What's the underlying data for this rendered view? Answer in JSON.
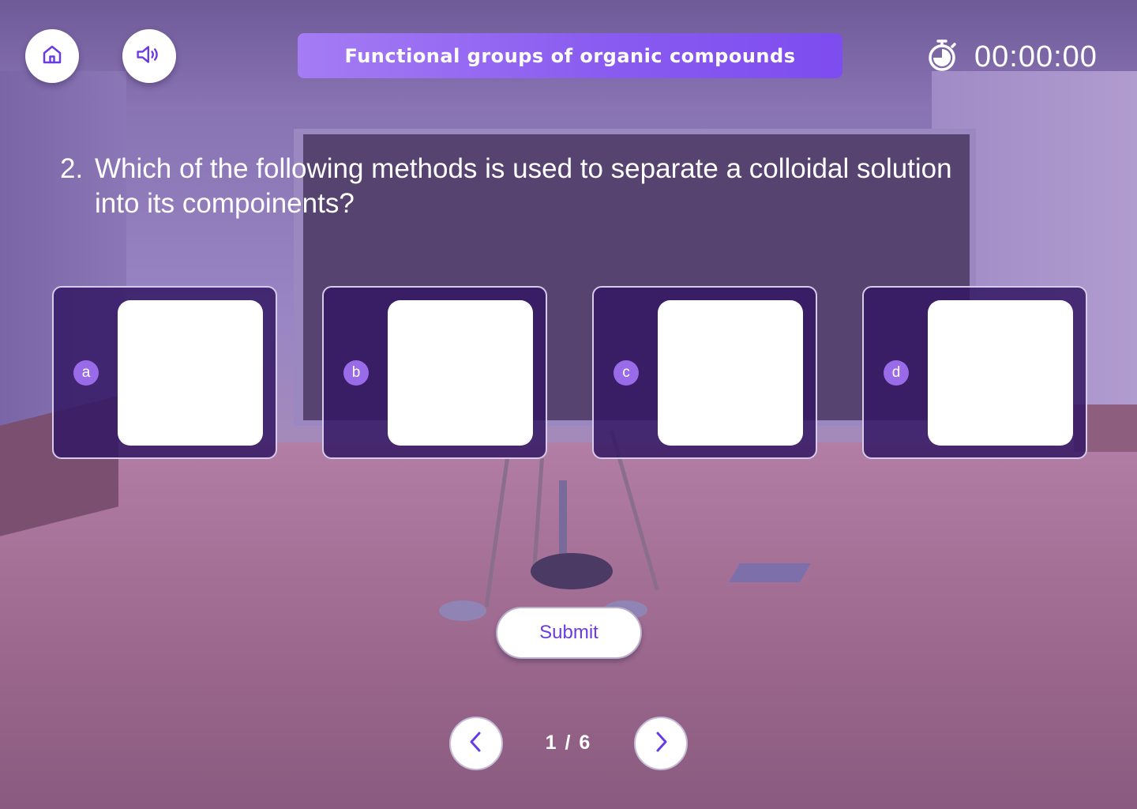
{
  "header": {
    "title": "Functional groups of organic compounds",
    "timer": "00:00:00",
    "home_icon": "home-icon",
    "sound_icon": "speaker-icon",
    "timer_icon": "stopwatch-icon"
  },
  "question": {
    "number": "2.",
    "text": "Which of the following methods is used to separate a colloidal solution into its compoinents?"
  },
  "options": [
    {
      "label": "a"
    },
    {
      "label": "b"
    },
    {
      "label": "c"
    },
    {
      "label": "d"
    }
  ],
  "submit_label": "Submit",
  "pagination": {
    "indicator": "1 / 6",
    "prev_icon": "chevron-left-icon",
    "next_icon": "chevron-right-icon"
  },
  "colors": {
    "accent": "#7e4cef",
    "option_bg": "#34186a",
    "badge": "#9a6be8"
  }
}
